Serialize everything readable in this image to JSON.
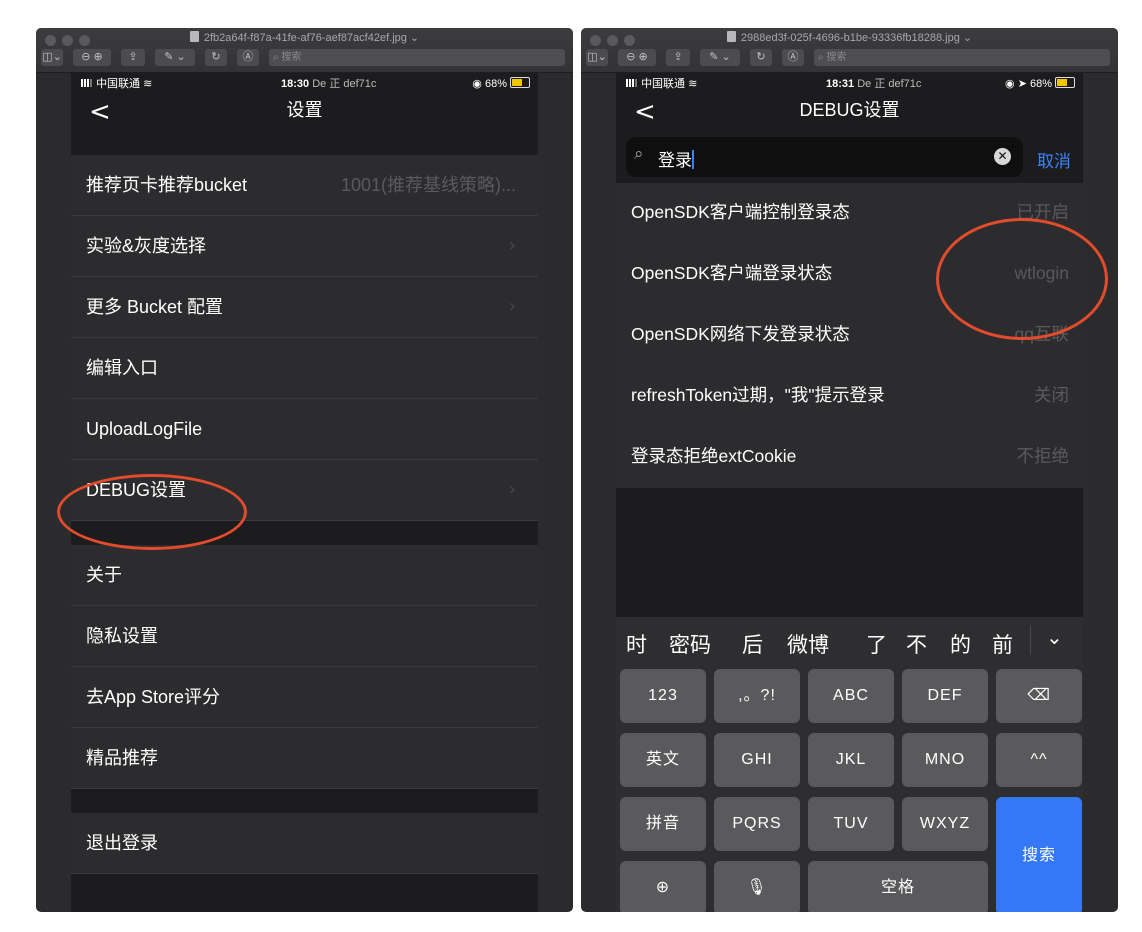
{
  "left_window": {
    "title": "2fb2a64f-f87a-41fe-af76-aef87acf42ef.jpg ⌄",
    "toolbar": {
      "search_placeholder": "搜索"
    },
    "status": {
      "carrier": "中国联通",
      "time": "18:30",
      "extra": "De 正 def71c",
      "battery": "68%"
    },
    "nav": {
      "back": "<",
      "title": "设置"
    },
    "groups": [
      [
        {
          "label": "推荐页卡推荐bucket",
          "value": "1001(推荐基线策略)..."
        },
        {
          "label": "实验&灰度选择",
          "chevron": true
        },
        {
          "label": "更多 Bucket 配置",
          "chevron": true
        },
        {
          "label": "编辑入口"
        },
        {
          "label": "UploadLogFile"
        },
        {
          "label": "DEBUG设置",
          "chevron": true,
          "highlight": true
        }
      ],
      [
        {
          "label": "关于"
        },
        {
          "label": "隐私设置"
        },
        {
          "label": "去App Store评分"
        },
        {
          "label": "精品推荐"
        }
      ],
      [
        {
          "label": "退出登录"
        }
      ]
    ]
  },
  "right_window": {
    "title": "2988ed3f-025f-4696-b1be-93336fb18288.jpg ⌄",
    "toolbar": {
      "search_placeholder": "搜索"
    },
    "status": {
      "carrier": "中国联通",
      "time": "18:31",
      "extra": "De 正 def71c",
      "battery": "68%"
    },
    "nav": {
      "back": "<",
      "title": "DEBUG设置"
    },
    "search": {
      "query": "登录",
      "cancel": "取消"
    },
    "results": [
      {
        "label": "OpenSDK客户端控制登录态",
        "value": "已开启"
      },
      {
        "label": "OpenSDK客户端登录状态",
        "value": "wtlogin"
      },
      {
        "label": "OpenSDK网络下发登录状态",
        "value": "qq互联"
      },
      {
        "label": "refreshToken过期，\"我\"提示登录",
        "value": "关闭"
      },
      {
        "label": "登录态拒绝extCookie",
        "value": "不拒绝"
      }
    ],
    "keyboard": {
      "candidates": [
        "时",
        "密码",
        "后",
        "微博",
        "了",
        "不",
        "的",
        "前"
      ],
      "more": "⌄",
      "keys": {
        "num": "123",
        "punct": ",。?!",
        "abc": "ABC",
        "def": "DEF",
        "backspace": "⌫",
        "english": "英文",
        "ghi": "GHI",
        "jkl": "JKL",
        "mno": "MNO",
        "emoticon": "^^",
        "pinyin": "拼音",
        "pqrs": "PQRS",
        "tuv": "TUV",
        "wxyz": "WXYZ",
        "search": "搜索",
        "globe": "⊕",
        "mic": "🎙",
        "space": "空格"
      }
    }
  },
  "colors": {
    "highlight_circle": "#e24b2c",
    "accent_blue": "#3478f6"
  }
}
